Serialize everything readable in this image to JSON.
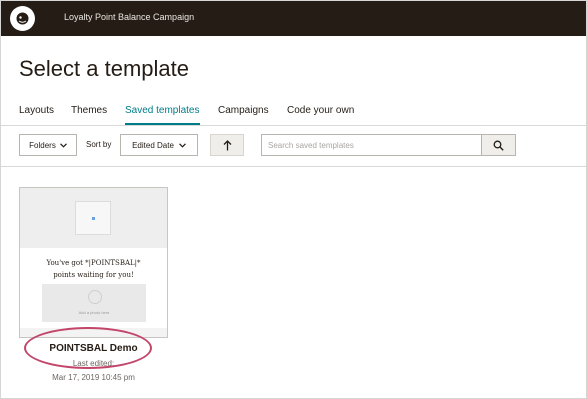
{
  "topbar": {
    "title": "Loyalty Point Balance Campaign"
  },
  "page": {
    "title": "Select a template"
  },
  "tabs": [
    {
      "label": "Layouts"
    },
    {
      "label": "Themes"
    },
    {
      "label": "Saved templates"
    },
    {
      "label": "Campaigns"
    },
    {
      "label": "Code your own"
    }
  ],
  "active_tab": "Saved templates",
  "toolbar": {
    "folders_label": "Folders",
    "sortby_label": "Sort by",
    "sort_value": "Edited Date",
    "search_placeholder": "Search saved templates"
  },
  "icons": {
    "logo": "mailchimp-freddie-icon",
    "search": "search-icon",
    "sort_direction": "arrow-up-icon",
    "folders_dropdown": "chevron-down-icon",
    "sort_dropdown": "chevron-down-icon",
    "image_placeholder": "image-icon"
  },
  "colors": {
    "topbar_bg": "#241c15",
    "accent": "#007c89",
    "highlight": "#c2456a"
  },
  "templates": [
    {
      "name": "POINTSBAL Demo",
      "last_edited_label": "Last edited:",
      "last_edited_date": "Mar 17, 2019 10:45 pm",
      "preview": {
        "headline_line1": "You've got *|POINTSBAL|*",
        "headline_line2": "points waiting for you!",
        "image_text": "Add a photo here"
      }
    }
  ]
}
